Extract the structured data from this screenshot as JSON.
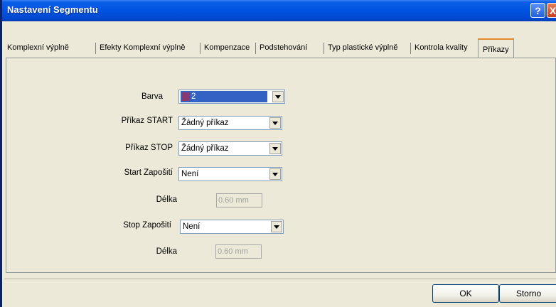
{
  "window": {
    "title": "Nastavení Segmentu",
    "help_icon": "?",
    "close_icon": "X"
  },
  "tabs": [
    {
      "label": "Komplexní výplně",
      "active": false
    },
    {
      "label": "Efekty Komplexní výplně",
      "active": false
    },
    {
      "label": "Kompenzace",
      "active": false
    },
    {
      "label": "Podstehování",
      "active": false
    },
    {
      "label": "Typ plastické výplně",
      "active": false
    },
    {
      "label": "Kontrola kvality",
      "active": false
    },
    {
      "label": "Příkazy",
      "active": true
    }
  ],
  "form": {
    "color": {
      "label": "Barva",
      "value": "2",
      "swatch_color": "#8a3a72"
    },
    "start_command": {
      "label": "Příkaz START",
      "value": "Žádný příkaz"
    },
    "stop_command": {
      "label": "Příkaz STOP",
      "value": "Žádný příkaz"
    },
    "start_tie": {
      "label": "Start Zapošití",
      "value": "Není"
    },
    "start_length": {
      "label": "Délka",
      "value": "0.60 mm"
    },
    "stop_tie": {
      "label": "Stop Zapošití",
      "value": "Není"
    },
    "stop_length": {
      "label": "Délka",
      "value": "0.60 mm"
    }
  },
  "buttons": {
    "ok": "OK",
    "cancel": "Storno"
  },
  "colors": {
    "title_bar": "#0054e3",
    "dialog_bg": "#ece9d8",
    "selection": "#3162c4"
  }
}
